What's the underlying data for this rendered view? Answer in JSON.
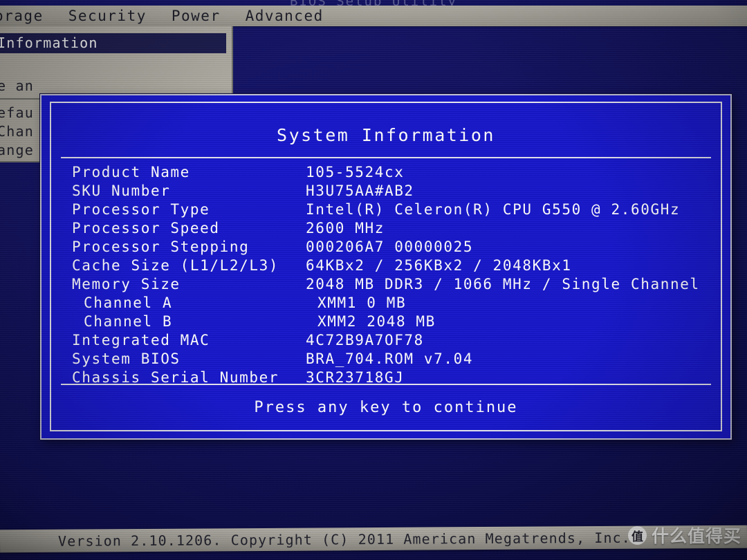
{
  "utility_title": "BIOS Setup Utility",
  "menu_bar": {
    "items": [
      {
        "label": "orage"
      },
      {
        "label": "Security"
      },
      {
        "label": "Power"
      },
      {
        "label": "Advanced"
      }
    ]
  },
  "left_panel": {
    "selected_item": "Information",
    "rows": [
      "e an",
      "efau",
      "Chan",
      "ange"
    ]
  },
  "dialog": {
    "title": "System Information",
    "rows": [
      {
        "label": "Product Name",
        "value": "105-5524cx",
        "indent": false
      },
      {
        "label": "SKU Number",
        "value": "H3U75AA#AB2",
        "indent": false
      },
      {
        "label": "Processor Type",
        "value": "Intel(R) Celeron(R) CPU G550 @ 2.60GHz",
        "indent": false
      },
      {
        "label": "Processor Speed",
        "value": "2600 MHz",
        "indent": false
      },
      {
        "label": "Processor Stepping",
        "value": "000206A7 00000025",
        "indent": false
      },
      {
        "label": "Cache Size (L1/L2/L3)",
        "value": "64KBx2 / 256KBx2 / 2048KBx1",
        "indent": false
      },
      {
        "label": "Memory Size",
        "value": "2048 MB DDR3 / 1066 MHz / Single Channel",
        "indent": false
      },
      {
        "label": "Channel A",
        "value": "XMM1 0 MB",
        "indent": true
      },
      {
        "label": "Channel B",
        "value": "XMM2 2048 MB",
        "indent": true
      },
      {
        "label": "Integrated MAC",
        "value": "4C72B9A7OF78",
        "indent": false
      },
      {
        "label": "System BIOS",
        "value": "BRA_704.ROM v7.04",
        "indent": false
      },
      {
        "label": "Chassis Serial Number",
        "value": "3CR23718GJ",
        "indent": false
      }
    ],
    "prompt": "Press any key to continue"
  },
  "footer": {
    "version_text": "Version 2.10.1206. Copyright (C) 2011 American Megatrends, Inc."
  },
  "watermark": {
    "badge": "值",
    "text": "什么值得买"
  },
  "colors": {
    "dialog_blue": "#1616cb",
    "background_navy": "#10105e",
    "menu_gray": "#a9a69d",
    "text_white": "#ffffff",
    "highlight_navy": "#1b1b4e"
  }
}
